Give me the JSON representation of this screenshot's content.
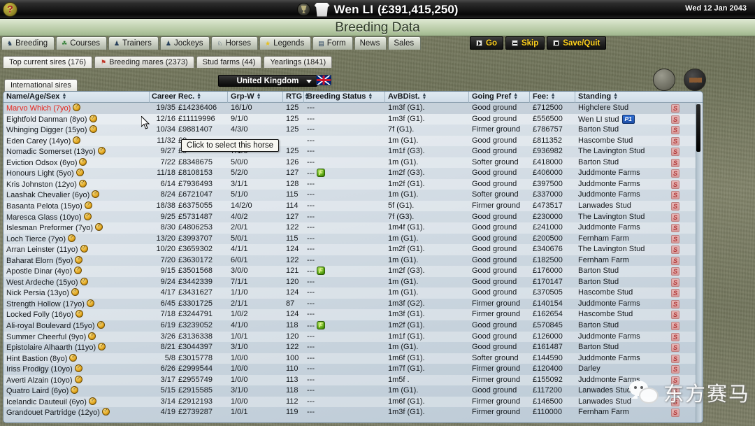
{
  "topbar": {
    "help_label": "?",
    "trophy_icon": "trophy-icon",
    "silks_icon": "racing-silks-icon",
    "owner_name": "Wen LI",
    "owner_cash": "(£391,415,250)",
    "date": "Wed 12 Jan 2043"
  },
  "title": "Breeding Data",
  "main_tabs": [
    {
      "label": "Breeding",
      "icon": "horse-icon"
    },
    {
      "label": "Courses",
      "icon": "course-icon"
    },
    {
      "label": "Trainers",
      "icon": "person-icon"
    },
    {
      "label": "Jockeys",
      "icon": "person-icon"
    },
    {
      "label": "Horses",
      "icon": "horse-head-icon"
    },
    {
      "label": "Legends",
      "icon": "star-icon"
    },
    {
      "label": "Form",
      "icon": "form-icon"
    },
    {
      "label": "News",
      "icon": ""
    },
    {
      "label": "Sales",
      "icon": ""
    }
  ],
  "actions": [
    {
      "label": "Go",
      "icon": "play-icon"
    },
    {
      "label": "Skip",
      "icon": "skip-icon"
    },
    {
      "label": "Save/Quit",
      "icon": "stop-icon"
    }
  ],
  "sub_tabs": [
    {
      "label": "Top current sires (176)",
      "icon": ""
    },
    {
      "label": "Breeding mares (2373)",
      "icon": "flag-icon"
    },
    {
      "label": "Stud farms (44)",
      "icon": ""
    },
    {
      "label": "Yearlings (1841)",
      "icon": ""
    }
  ],
  "filter_tab": "International sires",
  "country": {
    "selected": "United Kingdom",
    "flag": "uk-flag-icon"
  },
  "side_buttons": [
    {
      "name": "coin-button"
    },
    {
      "name": "horseshoes-button"
    }
  ],
  "tooltip": "Click to select this horse",
  "columns": [
    "Name/Age/Sex",
    "Career Rec.",
    "Grp-W",
    "RTG",
    "Breeding Status",
    "AvBDist.",
    "Going Pref",
    "Fee:",
    "Standing"
  ],
  "rows": [
    {
      "name": "Marvo Which (7yo)",
      "sex": "M",
      "highlight": true,
      "rec_wins": "19/35",
      "rec_money": "£14236406",
      "grp": "16/1/0",
      "rtg": "125",
      "status": "---",
      "flag": false,
      "dist": "1m3f  (G1).",
      "going": "Good ground",
      "fee": "£712500",
      "standing": "Highclere Stud",
      "p1": false
    },
    {
      "name": "Eightfold Danman (8yo)",
      "sex": "M",
      "highlight": false,
      "rec_wins": "12/16",
      "rec_money": "£11119996",
      "grp": "9/1/0",
      "rtg": "125",
      "status": "---",
      "flag": false,
      "dist": "1m3f  (G1).",
      "going": "Good ground",
      "fee": "£556500",
      "standing": "Wen LI stud",
      "p1": true
    },
    {
      "name": "Whinging Digger (15yo)",
      "sex": "M",
      "highlight": false,
      "rec_wins": "10/34",
      "rec_money": "£9881407",
      "grp": "4/3/0",
      "rtg": "125",
      "status": "---",
      "flag": false,
      "dist": "7f  (G1).",
      "going": "Firmer ground",
      "fee": "£786757",
      "standing": "Barton Stud",
      "p1": false
    },
    {
      "name": "Eden Carey (14yo)",
      "sex": "M",
      "highlight": false,
      "rec_wins": "11/32",
      "rec_money": "£9",
      "grp": "",
      "rtg": "",
      "status": "---",
      "flag": false,
      "dist": "1m  (G1).",
      "going": "Good ground",
      "fee": "£811352",
      "standing": "Hascombe Stud",
      "p1": false
    },
    {
      "name": "Nomadic Somerset (13yo)",
      "sex": "M",
      "highlight": false,
      "rec_wins": "9/27",
      "rec_money": "£9",
      "grp": "7/1/0",
      "rtg": "125",
      "status": "---",
      "flag": false,
      "dist": "1m1f  (G3).",
      "going": "Good ground",
      "fee": "£936982",
      "standing": "The Lavington Stud",
      "p1": false
    },
    {
      "name": "Eviction Odsox (6yo)",
      "sex": "M",
      "highlight": false,
      "rec_wins": "7/22",
      "rec_money": "£8348675",
      "grp": "5/0/0",
      "rtg": "126",
      "status": "---",
      "flag": false,
      "dist": "1m  (G1).",
      "going": "Softer ground",
      "fee": "£418000",
      "standing": "Barton Stud",
      "p1": false
    },
    {
      "name": "Honours Light (5yo)",
      "sex": "M",
      "highlight": false,
      "rec_wins": "11/18",
      "rec_money": "£8108153",
      "grp": "5/2/0",
      "rtg": "127",
      "status": "---",
      "flag": true,
      "dist": "1m2f  (G3).",
      "going": "Good ground",
      "fee": "£406000",
      "standing": "Juddmonte Farms",
      "p1": false
    },
    {
      "name": "Kris Johnston (12yo)",
      "sex": "M",
      "highlight": false,
      "rec_wins": "6/14",
      "rec_money": "£7936493",
      "grp": "3/1/1",
      "rtg": "128",
      "status": "---",
      "flag": false,
      "dist": "1m2f  (G1).",
      "going": "Good ground",
      "fee": "£397500",
      "standing": "Juddmonte Farms",
      "p1": false
    },
    {
      "name": "Laashak Chevalier (6yo)",
      "sex": "M",
      "highlight": false,
      "rec_wins": "8/24",
      "rec_money": "£6721047",
      "grp": "5/1/0",
      "rtg": "115",
      "status": "---",
      "flag": false,
      "dist": "1m  (G1).",
      "going": "Softer ground",
      "fee": "£337000",
      "standing": "Juddmonte Farms",
      "p1": false
    },
    {
      "name": "Basanta Pelota (15yo)",
      "sex": "M",
      "highlight": false,
      "rec_wins": "18/38",
      "rec_money": "£6375055",
      "grp": "14/2/0",
      "rtg": "114",
      "status": "---",
      "flag": false,
      "dist": "5f  (G1).",
      "going": "Firmer ground",
      "fee": "£473517",
      "standing": "Lanwades Stud",
      "p1": false
    },
    {
      "name": "Maresca Glass (10yo)",
      "sex": "M",
      "highlight": false,
      "rec_wins": "9/25",
      "rec_money": "£5731487",
      "grp": "4/0/2",
      "rtg": "127",
      "status": "---",
      "flag": false,
      "dist": "7f  (G3).",
      "going": "Good ground",
      "fee": "£230000",
      "standing": "The Lavington Stud",
      "p1": false
    },
    {
      "name": "Islesman Preformer (7yo)",
      "sex": "M",
      "highlight": false,
      "rec_wins": "8/30",
      "rec_money": "£4806253",
      "grp": "2/0/1",
      "rtg": "122",
      "status": "---",
      "flag": false,
      "dist": "1m4f  (G1).",
      "going": "Good ground",
      "fee": "£241000",
      "standing": "Juddmonte Farms",
      "p1": false
    },
    {
      "name": "Loch Tierce (7yo)",
      "sex": "M",
      "highlight": false,
      "rec_wins": "13/20",
      "rec_money": "£3993707",
      "grp": "5/0/1",
      "rtg": "115",
      "status": "---",
      "flag": false,
      "dist": "1m  (G1).",
      "going": "Good ground",
      "fee": "£200500",
      "standing": "Fernham Farm",
      "p1": false
    },
    {
      "name": "Arran Leinster (11yo)",
      "sex": "M",
      "highlight": false,
      "rec_wins": "10/20",
      "rec_money": "£3659302",
      "grp": "4/1/1",
      "rtg": "124",
      "status": "---",
      "flag": false,
      "dist": "1m2f  (G1).",
      "going": "Good ground",
      "fee": "£340676",
      "standing": "The Lavington Stud",
      "p1": false
    },
    {
      "name": "Baharat Elorn (5yo)",
      "sex": "M",
      "highlight": false,
      "rec_wins": "7/20",
      "rec_money": "£3630172",
      "grp": "6/0/1",
      "rtg": "122",
      "status": "---",
      "flag": false,
      "dist": "1m  (G1).",
      "going": "Good ground",
      "fee": "£182500",
      "standing": "Fernham Farm",
      "p1": false
    },
    {
      "name": "Apostle Dinar (4yo)",
      "sex": "M",
      "highlight": false,
      "rec_wins": "9/15",
      "rec_money": "£3501568",
      "grp": "3/0/0",
      "rtg": "121",
      "status": "---",
      "flag": true,
      "dist": "1m2f  (G3).",
      "going": "Good ground",
      "fee": "£176000",
      "standing": "Barton Stud",
      "p1": false
    },
    {
      "name": "West Ardeche (15yo)",
      "sex": "M",
      "highlight": false,
      "rec_wins": "9/24",
      "rec_money": "£3442339",
      "grp": "7/1/1",
      "rtg": "120",
      "status": "---",
      "flag": false,
      "dist": "1m  (G1).",
      "going": "Good ground",
      "fee": "£170147",
      "standing": "Barton Stud",
      "p1": false
    },
    {
      "name": "Nick Persia (13yo)",
      "sex": "M",
      "highlight": false,
      "rec_wins": "4/17",
      "rec_money": "£3431627",
      "grp": "1/1/0",
      "rtg": "124",
      "status": "---",
      "flag": false,
      "dist": "1m  (G1).",
      "going": "Good ground",
      "fee": "£370505",
      "standing": "Hascombe Stud",
      "p1": false
    },
    {
      "name": "Strength Hollow (17yo)",
      "sex": "M",
      "highlight": false,
      "rec_wins": "6/45",
      "rec_money": "£3301725",
      "grp": "2/1/1",
      "rtg": "87",
      "status": "---",
      "flag": false,
      "dist": "1m3f  (G2).",
      "going": "Firmer ground",
      "fee": "£140154",
      "standing": "Juddmonte Farms",
      "p1": false
    },
    {
      "name": "Locked Folly (16yo)",
      "sex": "M",
      "highlight": false,
      "rec_wins": "7/18",
      "rec_money": "£3244791",
      "grp": "1/0/2",
      "rtg": "124",
      "status": "---",
      "flag": false,
      "dist": "1m3f  (G1).",
      "going": "Firmer ground",
      "fee": "£162654",
      "standing": "Hascombe Stud",
      "p1": false
    },
    {
      "name": "Ali-royal Boulevard (15yo)",
      "sex": "M",
      "highlight": false,
      "rec_wins": "6/19",
      "rec_money": "£3239052",
      "grp": "4/1/0",
      "rtg": "118",
      "status": "---",
      "flag": true,
      "dist": "1m2f  (G1).",
      "going": "Good ground",
      "fee": "£570845",
      "standing": "Barton Stud",
      "p1": false
    },
    {
      "name": "Summer Cheerful (9yo)",
      "sex": "M",
      "highlight": false,
      "rec_wins": "3/26",
      "rec_money": "£3136338",
      "grp": "1/0/1",
      "rtg": "120",
      "status": "---",
      "flag": false,
      "dist": "1m1f  (G1).",
      "going": "Good ground",
      "fee": "£126000",
      "standing": "Juddmonte Farms",
      "p1": false
    },
    {
      "name": "Epistolaire Alhaarth (11yo)",
      "sex": "M",
      "highlight": false,
      "rec_wins": "8/21",
      "rec_money": "£3044397",
      "grp": "3/1/0",
      "rtg": "122",
      "status": "---",
      "flag": false,
      "dist": "1m  (G1).",
      "going": "Good ground",
      "fee": "£161487",
      "standing": "Barton Stud",
      "p1": false
    },
    {
      "name": "Hint Bastion (8yo)",
      "sex": "M",
      "highlight": false,
      "rec_wins": "5/8",
      "rec_money": "£3015778",
      "grp": "1/0/0",
      "rtg": "100",
      "status": "---",
      "flag": false,
      "dist": "1m6f  (G1).",
      "going": "Softer ground",
      "fee": "£144590",
      "standing": "Juddmonte Farms",
      "p1": false
    },
    {
      "name": "Iriss Prodigy (10yo)",
      "sex": "M",
      "highlight": false,
      "rec_wins": "6/26",
      "rec_money": "£2999544",
      "grp": "1/0/0",
      "rtg": "110",
      "status": "---",
      "flag": false,
      "dist": "1m7f  (G1).",
      "going": "Firmer ground",
      "fee": "£120400",
      "standing": "Darley",
      "p1": false
    },
    {
      "name": "Averti Alzain (10yo)",
      "sex": "M",
      "highlight": false,
      "rec_wins": "3/17",
      "rec_money": "£2955749",
      "grp": "1/0/0",
      "rtg": "113",
      "status": "---",
      "flag": false,
      "dist": "1m5f .",
      "going": "Firmer ground",
      "fee": "£155092",
      "standing": "Juddmonte Farms",
      "p1": false
    },
    {
      "name": "Quatro Laird (6yo)",
      "sex": "M",
      "highlight": false,
      "rec_wins": "5/15",
      "rec_money": "£2915585",
      "grp": "3/1/0",
      "rtg": "118",
      "status": "---",
      "flag": false,
      "dist": "1m  (G1).",
      "going": "Good ground",
      "fee": "£117200",
      "standing": "Lanwades Stud",
      "p1": false
    },
    {
      "name": "Icelandic Dauteuil (6yo)",
      "sex": "M",
      "highlight": false,
      "rec_wins": "3/14",
      "rec_money": "£2912193",
      "grp": "1/0/0",
      "rtg": "112",
      "status": "---",
      "flag": false,
      "dist": "1m6f  (G1).",
      "going": "Firmer ground",
      "fee": "£146500",
      "standing": "Lanwades Stud",
      "p1": false
    },
    {
      "name": "Grandouet Partridge (12yo)",
      "sex": "M",
      "highlight": false,
      "rec_wins": "4/19",
      "rec_money": "£2739287",
      "grp": "1/0/1",
      "rtg": "119",
      "status": "---",
      "flag": false,
      "dist": "1m3f  (G1).",
      "going": "Firmer ground",
      "fee": "£110000",
      "standing": "Fernham Farm",
      "p1": false
    }
  ],
  "row_tag": "S",
  "watermark": "东方赛马"
}
